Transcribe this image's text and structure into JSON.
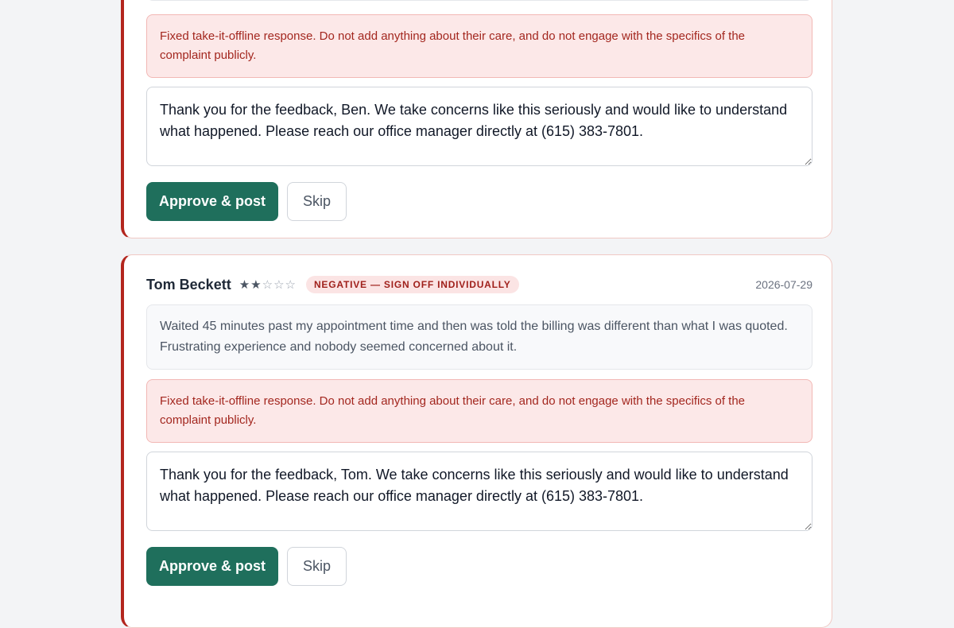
{
  "reviews": [
    {
      "guidance": "Fixed take-it-offline response. Do not add anything about their care, and do not engage with the specifics of the complaint publicly.",
      "reply": "Thank you for the feedback, Ben. We take concerns like this seriously and would like to understand what happened. Please reach our office manager directly at (615) 383-7801.",
      "approve_label": "Approve & post",
      "skip_label": "Skip"
    },
    {
      "reviewer": "Tom Beckett",
      "rating": 2,
      "stars_max": 5,
      "badge": "NEGATIVE — SIGN OFF INDIVIDUALLY",
      "date": "2026-07-29",
      "review_text": "Waited 45 minutes past my appointment time and then was told the billing was different than what I was quoted. Frustrating experience and nobody seemed concerned about it.",
      "guidance": "Fixed take-it-offline response. Do not add anything about their care, and do not engage with the specifics of the complaint publicly.",
      "reply": "Thank you for the feedback, Tom. We take concerns like this seriously and would like to understand what happened. Please reach our office manager directly at (615) 383-7801.",
      "approve_label": "Approve & post",
      "skip_label": "Skip"
    }
  ],
  "colors": {
    "accent": "#1f6f5c",
    "negative": "#b3261e",
    "badge_bg": "#fbe4e4"
  }
}
